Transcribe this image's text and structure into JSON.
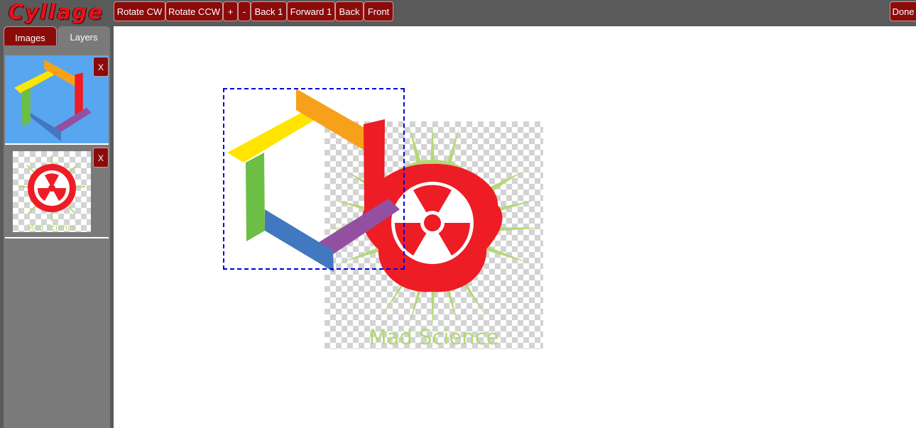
{
  "app": {
    "logo_text": "Cyllage"
  },
  "toolbar": {
    "rotate_cw": "Rotate CW",
    "rotate_ccw": "Rotate CCW",
    "zoom_in": "+",
    "zoom_out": "-",
    "back_1": "Back 1",
    "forward_1": "Forward 1",
    "back": "Back",
    "front": "Front",
    "done": "Done"
  },
  "sidebar": {
    "tabs": [
      {
        "label": "Images",
        "active": false
      },
      {
        "label": "Layers",
        "active": true
      }
    ],
    "layers": [
      {
        "name": "hexagon-logo",
        "selected": true,
        "remove_label": "X"
      },
      {
        "name": "mad-science-logo",
        "selected": false,
        "remove_label": "X",
        "caption": "Mad Science"
      }
    ]
  },
  "canvas": {
    "mad_science_text": "Mad Science"
  },
  "colors": {
    "brand_red": "#8b0a0a",
    "logo_red": "#e8111b",
    "selected_layer_bg": "#58a6f0",
    "selection_border": "#0000dd",
    "hex_yellow": "#ffe500",
    "hex_orange": "#f7a11a",
    "hex_red": "#ee1c25",
    "hex_purple": "#9350a0",
    "hex_blue": "#4278c0",
    "hex_green": "#6cbe45",
    "ms_green": "#b5d877",
    "ms_red": "#ee1c25"
  }
}
